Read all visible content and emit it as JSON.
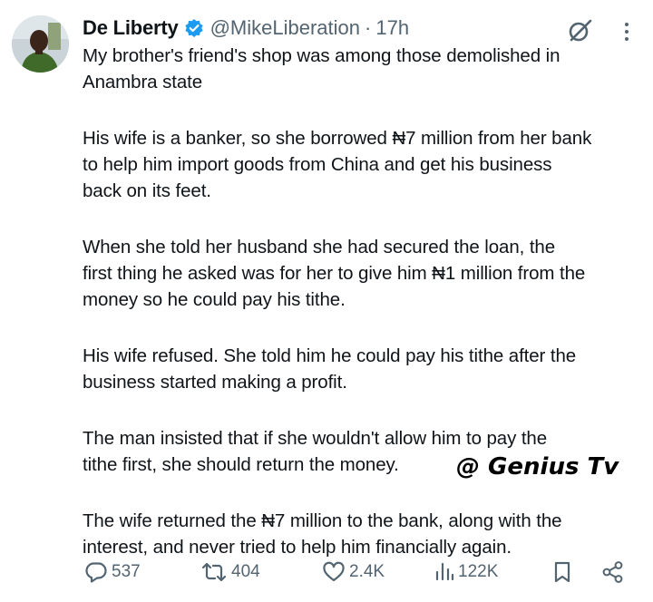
{
  "tweet": {
    "author_name": "De Liberty",
    "handle": "@MikeLiberation",
    "separator": "·",
    "time": "17h",
    "paragraphs": [
      "My brother's friend's shop was among those demolished in\nAnambra state",
      "His wife is a banker, so she borrowed ₦7 million from her bank\nto help him import goods from China and get his business\nback on its feet.",
      "When she told her husband she had secured the loan, the\nfirst thing he asked was for her to give him ₦1 million from the\nmoney so he could pay his tithe.",
      "His wife refused. She told him he could pay his tithe after the\nbusiness started making a profit.",
      "The man insisted that if she wouldn't allow him to pay the\ntithe first, she should return the money.",
      "The wife returned the ₦7 million to the bank, along with the\ninterest, and never tried to help him financially again."
    ],
    "watermark": "@ Genius Tv",
    "actions": {
      "replies": "537",
      "reposts": "404",
      "likes": "2.4K",
      "views": "122K"
    },
    "icons": {
      "verified": "verified-badge-icon",
      "grok": "grok-icon",
      "more": "more-icon",
      "reply": "reply-icon",
      "repost": "repost-icon",
      "like": "heart-icon",
      "views": "views-icon",
      "bookmark": "bookmark-icon",
      "share": "share-icon"
    },
    "colors": {
      "text": "#0f1419",
      "secondary": "#536471",
      "verified_blue": "#1d9bf0"
    }
  }
}
